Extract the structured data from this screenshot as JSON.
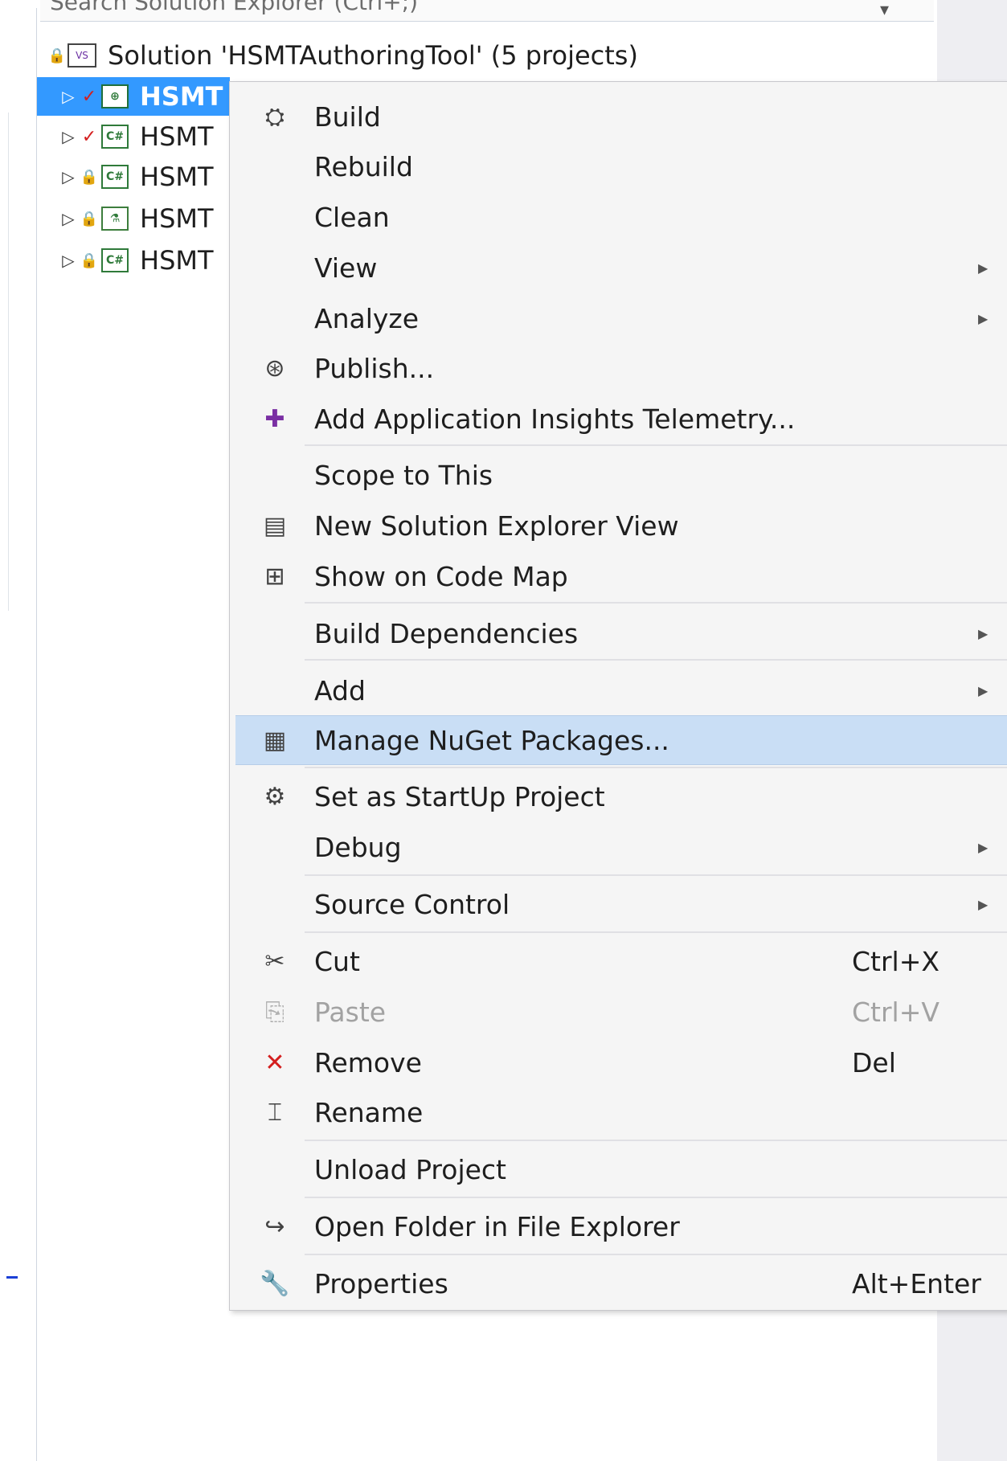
{
  "search": {
    "text": "Search Solution Explorer (Ctrl+;)"
  },
  "solution": {
    "label": "Solution 'HSMTAuthoringTool' (5 projects)",
    "projects": [
      {
        "label": "HSMT",
        "badge": "✓",
        "icon_label": "⊕",
        "icon": "web-project-icon"
      },
      {
        "label": "HSMT",
        "badge": "✓",
        "icon_label": "C#",
        "icon": "csharp-project-icon"
      },
      {
        "label": "HSMT",
        "badge": "🔒",
        "icon_label": "C#",
        "icon": "csharp-project-icon"
      },
      {
        "label": "HSMT",
        "badge": "🔒",
        "icon_label": "⚗",
        "icon": "test-project-icon"
      },
      {
        "label": "HSMT",
        "badge": "🔒",
        "icon_label": "C#",
        "icon": "csharp-project-icon"
      }
    ]
  },
  "menu": {
    "items": [
      {
        "label": "Build",
        "icon": "build-icon",
        "glyph": "⛭"
      },
      {
        "label": "Rebuild"
      },
      {
        "label": "Clean"
      },
      {
        "label": "View",
        "submenu": "▶"
      },
      {
        "label": "Analyze",
        "submenu": "▶"
      },
      {
        "label": "Publish...",
        "icon": "publish-icon",
        "glyph": "⊛"
      },
      {
        "label": "Add Application Insights Telemetry...",
        "icon": "app-insights-icon",
        "glyph": "✚"
      },
      {
        "label": "Scope to This"
      },
      {
        "label": "New Solution Explorer View",
        "icon": "new-explorer-view-icon",
        "glyph": "▤"
      },
      {
        "label": "Show on Code Map",
        "icon": "code-map-icon",
        "glyph": "⊞"
      },
      {
        "label": "Build Dependencies",
        "submenu": "▶"
      },
      {
        "label": "Add",
        "submenu": "▶"
      },
      {
        "label": "Manage NuGet Packages...",
        "icon": "nuget-icon",
        "glyph": "▦"
      },
      {
        "label": "Set as StartUp Project",
        "icon": "gear-icon",
        "glyph": "⚙"
      },
      {
        "label": "Debug",
        "submenu": "▶"
      },
      {
        "label": "Source Control",
        "submenu": "▶"
      },
      {
        "label": "Cut",
        "shortcut": "Ctrl+X",
        "icon": "cut-icon",
        "glyph": "✂"
      },
      {
        "label": "Paste",
        "shortcut": "Ctrl+V",
        "icon": "paste-icon",
        "glyph": "⎘"
      },
      {
        "label": "Remove",
        "shortcut": "Del",
        "icon": "remove-icon",
        "glyph": "✕"
      },
      {
        "label": "Rename",
        "icon": "rename-icon",
        "glyph": "⌶"
      },
      {
        "label": "Unload Project"
      },
      {
        "label": "Open Folder in File Explorer",
        "icon": "open-folder-icon",
        "glyph": "↪"
      },
      {
        "label": "Properties",
        "shortcut": "Alt+Enter",
        "icon": "wrench-icon",
        "glyph": "🔧"
      }
    ]
  },
  "colors": {
    "selection": "#3399ff",
    "menu_highlight": "#c9def5",
    "remove_icon": "#d41e1e"
  }
}
